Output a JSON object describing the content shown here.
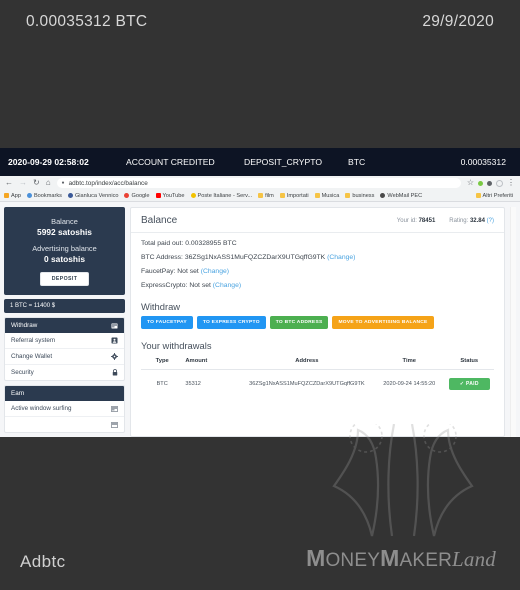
{
  "outer_header": {
    "amount": "0.00035312 BTC",
    "date": "29/9/2020"
  },
  "footer": {
    "site_name": "Adbtc",
    "watermark_money": "M",
    "watermark_oney": "ONEY",
    "watermark_maker_m": "M",
    "watermark_aker": "AKER",
    "watermark_land": "Land"
  },
  "transaction_bar": {
    "datetime": "2020-09-29 02:58:02",
    "event": "ACCOUNT CREDITED",
    "type": "DEPOSIT_CRYPTO",
    "currency": "BTC",
    "amount": "0.00035312"
  },
  "browser": {
    "url": "adbtc.top/index/acc/balance",
    "back_icon": "←",
    "forward_icon": "→",
    "reload_icon": "↻",
    "home_icon": "⌂",
    "lock_icon": "●",
    "star_icon": "☆",
    "menu_icon": "⋮",
    "bookmarks": [
      {
        "label": "App",
        "color": "#f5a623"
      },
      {
        "label": "Bookmarks",
        "color": "#4a90d9"
      },
      {
        "label": "Gianluca Vennico",
        "color": "#3b5998"
      },
      {
        "label": "Google",
        "color": "#ea4335"
      },
      {
        "label": "YouTube",
        "color": "#ff0000"
      },
      {
        "label": "Poste Italiane - Serv...",
        "color": "#f2c200"
      },
      {
        "label": "film",
        "color": "#f6c445"
      },
      {
        "label": "Importati",
        "color": "#f6c445"
      },
      {
        "label": "Musica",
        "color": "#f6c445"
      },
      {
        "label": "business",
        "color": "#f6c445"
      },
      {
        "label": "WebMail PEC",
        "color": "#4a4a4a"
      }
    ],
    "other_bookmarks": {
      "label": "Altri Preferiti",
      "color": "#f6c445"
    }
  },
  "sidebar": {
    "balance_label": "Balance",
    "balance_value": "5992 satoshis",
    "adv_label": "Advertising balance",
    "adv_value": "0 satoshis",
    "deposit_label": "DEPOSIT",
    "rate": "1 BTC = 11400 $",
    "menu_primary": [
      {
        "label": "Withdraw",
        "icon": "card-icon",
        "active": true
      },
      {
        "label": "Referral system",
        "icon": "contact-card-icon",
        "active": false
      },
      {
        "label": "Change Wallet",
        "icon": "gear-icon",
        "active": false
      },
      {
        "label": "Security",
        "icon": "lock-icon",
        "active": false
      }
    ],
    "menu_earn": [
      {
        "label": "Earn",
        "icon": "",
        "active": true
      },
      {
        "label": "Active window surfing",
        "icon": "window-icon",
        "active": false
      }
    ]
  },
  "content": {
    "title": "Balance",
    "your_id_label": "Your id:",
    "your_id": "78451",
    "rating_label": "Rating:",
    "rating": "32.84",
    "rating_help": "(?)",
    "lines": [
      {
        "text": "Total paid out: 0.00328955 BTC",
        "link": ""
      },
      {
        "text": "BTC Address: 36ZSg1NxASS1MuFQZCZDarX9UTGqffG9TK",
        "link": "(Change)"
      },
      {
        "text": "FaucetPay: Not set",
        "link": "(Change)"
      },
      {
        "text": "ExpressCrypto: Not set",
        "link": "(Change)"
      }
    ],
    "withdraw_title": "Withdraw",
    "withdraw_buttons": [
      {
        "label": "TO FAUCETPAY",
        "color": "#2196f3"
      },
      {
        "label": "TO EXPRESS CRYPTO",
        "color": "#2196f3"
      },
      {
        "label": "TO BTC ADDRESS",
        "color": "#4caf50"
      },
      {
        "label": "MOVE TO ADVERTISING BALANCE",
        "color": "#f5a318"
      }
    ],
    "withdrawals_title": "Your withdrawals",
    "table": {
      "columns": [
        "Type",
        "Amount",
        "Address",
        "Time",
        "Status"
      ],
      "rows": [
        {
          "type": "BTC",
          "amount": "35312",
          "address": "36ZSg1NxASS1MuFQZCZDarX9UTGqffG9TK",
          "time": "2020-09-24 14:55:20",
          "status": "PAID",
          "status_icon": "✓"
        }
      ]
    }
  }
}
